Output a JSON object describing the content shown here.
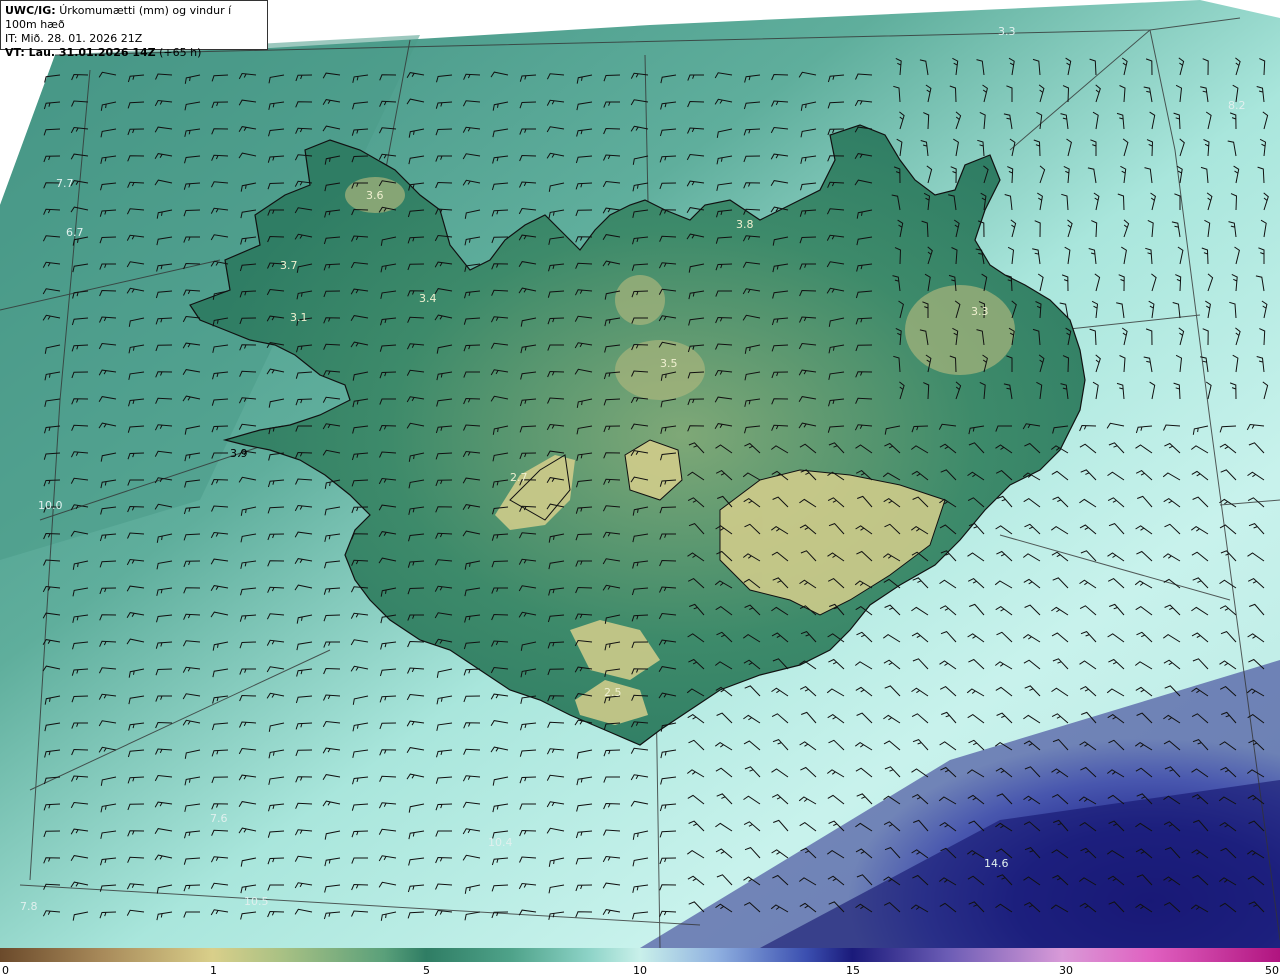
{
  "header": {
    "model": "UWC/IG:",
    "title": "Úrkomumætti (mm) og vindur í 100m hæð",
    "it": "IT: Mið. 28. 01. 2026 21Z",
    "vt_bold": "VT: Lau. 31.01.2026 14Z",
    "vt_rest": "(+65 h)"
  },
  "map_labels": [
    {
      "text": "3.3",
      "color": "#e0f0ee"
    },
    {
      "text": "8.2",
      "color": "#e0f0ee"
    },
    {
      "text": "7.7",
      "color": "#e0f0ee"
    },
    {
      "text": "6.7",
      "color": "#e0f0ee"
    },
    {
      "text": "3.6",
      "color": "#f0f0d0"
    },
    {
      "text": "3.7",
      "color": "#f0f0d0"
    },
    {
      "text": "3.4",
      "color": "#f0f0d0"
    },
    {
      "text": "3.1",
      "color": "#f0f0d0"
    },
    {
      "text": "3.8",
      "color": "#f0f0d0"
    },
    {
      "text": "3.3",
      "color": "#f0f0d0"
    },
    {
      "text": "3.5",
      "color": "#f0f0d0"
    },
    {
      "text": "3.9",
      "color": "#000000"
    },
    {
      "text": "2.7",
      "color": "#f0f0d0"
    },
    {
      "text": "10.0",
      "color": "#e0f0ee"
    },
    {
      "text": "2.5",
      "color": "#f0f0d0"
    },
    {
      "text": "7.6",
      "color": "#e0f0ee"
    },
    {
      "text": "10.4",
      "color": "#e0f0ee"
    },
    {
      "text": "14.6",
      "color": "#e0f0ee"
    },
    {
      "text": "10.5",
      "color": "#e0f0ee"
    },
    {
      "text": "7.8",
      "color": "#e0f0ee"
    }
  ],
  "legend": {
    "ticks": [
      "0",
      "1",
      "5",
      "10",
      "15",
      "30",
      "50"
    ]
  },
  "colors": {
    "sea_low": "#8dd3c7",
    "land": "#2f7d64",
    "highland": "#d9cf8a",
    "heavy": "#1a1a7a",
    "line": "#222222"
  }
}
